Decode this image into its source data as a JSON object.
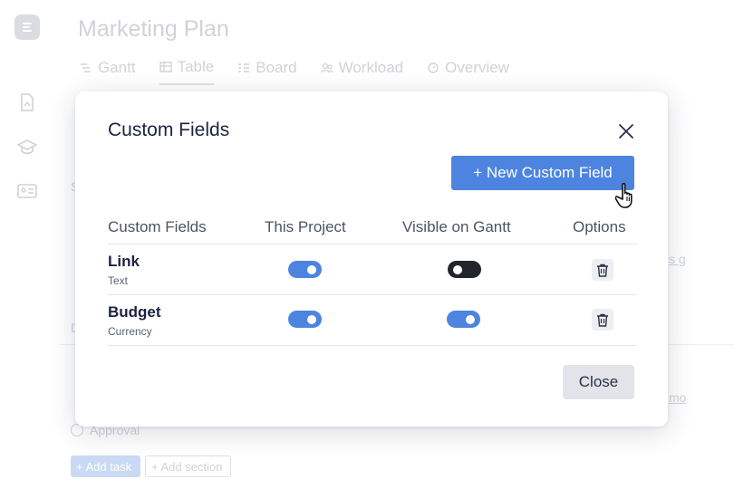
{
  "app": {
    "page_title": "Marketing Plan",
    "tabs": [
      {
        "label": "Gantt",
        "icon": "gantt-icon"
      },
      {
        "label": "Table",
        "icon": "table-icon",
        "active": true
      },
      {
        "label": "Board",
        "icon": "board-icon"
      },
      {
        "label": "Workload",
        "icon": "workload-icon"
      },
      {
        "label": "Overview",
        "icon": "overview-icon"
      }
    ],
    "sidebar_icons": [
      "document-icon",
      "graduation-cap-icon",
      "id-card-icon"
    ],
    "background": {
      "fragment_s": "S",
      "fragment_d": "D",
      "fragment_link": "s g",
      "fragment_mo": "mo",
      "approval_task": "Approval",
      "add_task_label": "+ Add task",
      "add_section_label": "+ Add section"
    }
  },
  "modal": {
    "title": "Custom Fields",
    "new_field_button": "+ New Custom Field",
    "columns": [
      "Custom Fields",
      "This Project",
      "Visible on Gantt",
      "Options"
    ],
    "fields": [
      {
        "name": "Link",
        "type": "Text",
        "this_project": true,
        "visible_on_gantt": false
      },
      {
        "name": "Budget",
        "type": "Currency",
        "this_project": true,
        "visible_on_gantt": true
      }
    ],
    "close_button": "Close"
  },
  "colors": {
    "accent": "#4d84e0",
    "toggle_off": "#23252d",
    "title_text": "#1c2340"
  }
}
